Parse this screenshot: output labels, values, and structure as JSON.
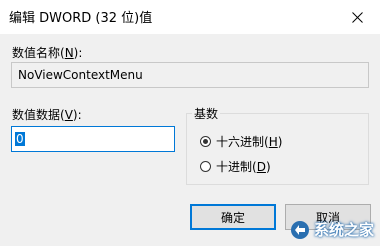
{
  "window": {
    "title": "编辑 DWORD (32 位)值"
  },
  "value_name": {
    "label_prefix": "数值名称(",
    "label_key": "N",
    "label_suffix": "):",
    "value": "NoViewContextMenu"
  },
  "value_data": {
    "label_prefix": "数值数据(",
    "label_key": "V",
    "label_suffix": "):",
    "value": "0"
  },
  "base": {
    "legend": "基数",
    "options": [
      {
        "label_prefix": "十六进制(",
        "key": "H",
        "label_suffix": ")",
        "checked": true
      },
      {
        "label_prefix": "十进制(",
        "key": "D",
        "label_suffix": ")",
        "checked": false
      }
    ]
  },
  "buttons": {
    "ok_label": "确定",
    "cancel_label": "取消"
  },
  "watermark": {
    "text": "系统之家"
  },
  "colors": {
    "accent": "#0078d7",
    "background": "#f0f0f0"
  }
}
